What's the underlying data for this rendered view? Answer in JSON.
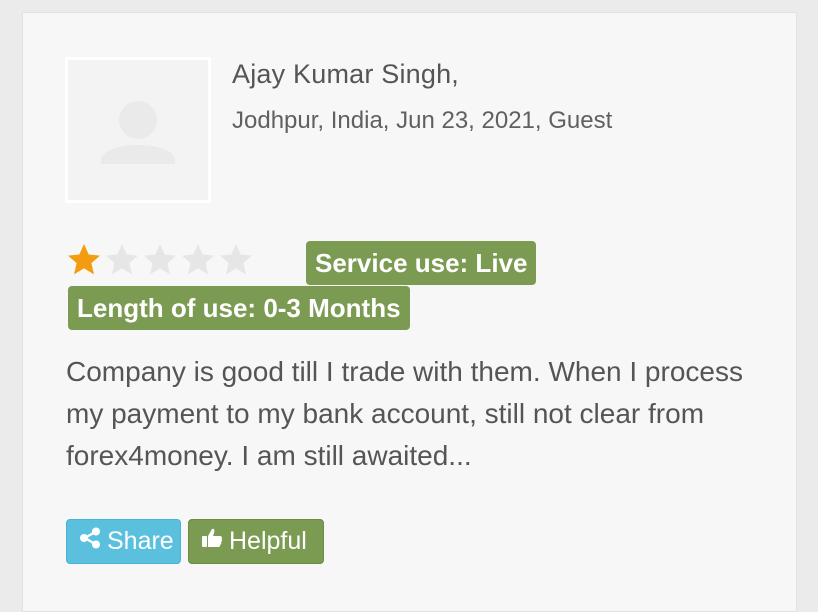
{
  "review": {
    "author": "Ajay Kumar Singh,",
    "meta": "Jodhpur, India, Jun 23, 2021, Guest",
    "rating": 1,
    "rating_max": 5,
    "tags": {
      "service_use": "Service use: Live",
      "length_of_use": "Length of use: 0-3 Months"
    },
    "text": "Company is good till I trade with them. When I process my payment to my bank account, still not clear from forex4money. I am still awaited..."
  },
  "actions": {
    "share_label": "Share",
    "helpful_label": "Helpful"
  },
  "icons": {
    "avatar": "user-placeholder-icon",
    "share": "share-icon",
    "helpful": "thumbs-up-icon",
    "star_filled": "star-filled-icon",
    "star_empty": "star-empty-icon"
  },
  "colors": {
    "star_filled": "#f39c12",
    "star_empty": "#e6e6e6",
    "tag_bg": "#7c9b52",
    "share_bg": "#5bc0de",
    "helpful_bg": "#7c9b52"
  }
}
